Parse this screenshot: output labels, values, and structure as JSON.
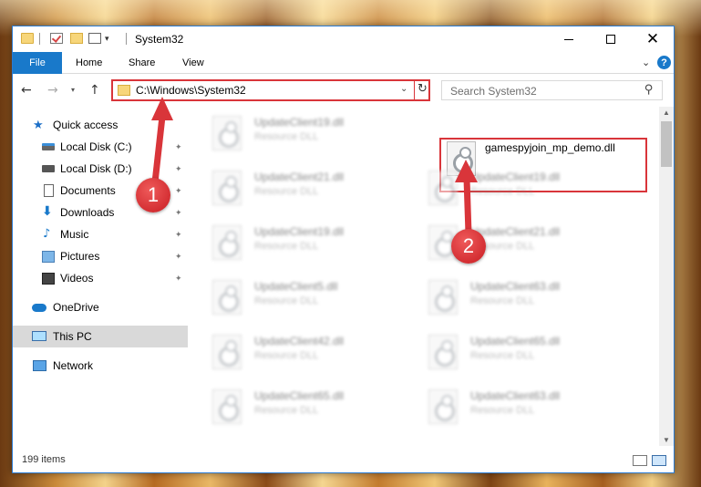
{
  "window": {
    "title": "System32",
    "controls": {
      "minimize": "minimize",
      "maximize": "maximize",
      "close": "✕"
    }
  },
  "ribbon": {
    "tabs": {
      "file": "File",
      "home": "Home",
      "share": "Share",
      "view": "View"
    },
    "help": "?"
  },
  "nav": {
    "back": "←",
    "forward": "→",
    "recent": "▾",
    "up": "↑",
    "address": "C:\\Windows\\System32",
    "address_dropdown": "⌄",
    "refresh": "↻",
    "search_placeholder": "Search System32",
    "search_glyph": "⚲"
  },
  "sidebar": {
    "items": [
      {
        "label": "Quick access",
        "icon": "star-icon",
        "pinned": false
      },
      {
        "label": "Local Disk (C:)",
        "icon": "drive-c-icon",
        "pinned": true
      },
      {
        "label": "Local Disk (D:)",
        "icon": "drive-icon",
        "pinned": true
      },
      {
        "label": "Documents",
        "icon": "documents-icon",
        "pinned": true
      },
      {
        "label": "Downloads",
        "icon": "downloads-icon",
        "pinned": true
      },
      {
        "label": "Music",
        "icon": "music-icon",
        "pinned": true
      },
      {
        "label": "Pictures",
        "icon": "pictures-icon",
        "pinned": true
      },
      {
        "label": "Videos",
        "icon": "videos-icon",
        "pinned": true
      },
      {
        "label": "OneDrive",
        "icon": "cloud-icon",
        "pinned": false
      },
      {
        "label": "This PC",
        "icon": "computer-icon",
        "pinned": false,
        "selected": true
      },
      {
        "label": "Network",
        "icon": "network-icon",
        "pinned": false
      }
    ],
    "pin_glyph": "📌"
  },
  "files": {
    "highlighted": {
      "name": "gamespyjoin_mp_demo.dll",
      "type": ""
    },
    "left_column": [
      {
        "name": "UpdateClient19.dll",
        "type": "Resource DLL"
      },
      {
        "name": "UpdateClient21.dll",
        "type": "Resource DLL"
      },
      {
        "name": "UpdateClient19.dll",
        "type": "Resource DLL"
      },
      {
        "name": "UpdateClient5.dll",
        "type": "Resource DLL"
      },
      {
        "name": "UpdateClient42.dll",
        "type": "Resource DLL"
      },
      {
        "name": "UpdateClient65.dll",
        "type": "Resource DLL"
      }
    ],
    "right_column": [
      {
        "name": "UpdateClient19.dll",
        "type": "Resource DLL"
      },
      {
        "name": "UpdateClient21.dll",
        "type": "Resource DLL"
      },
      {
        "name": "UpdateClient63.dll",
        "type": "Resource DLL"
      },
      {
        "name": "UpdateClient65.dll",
        "type": "Resource DLL"
      },
      {
        "name": "UpdateClient63.dll",
        "type": "Resource DLL"
      }
    ]
  },
  "status": {
    "item_count": "199 items"
  },
  "annotations": {
    "step1": "1",
    "step2": "2",
    "color": "#d9353a"
  }
}
